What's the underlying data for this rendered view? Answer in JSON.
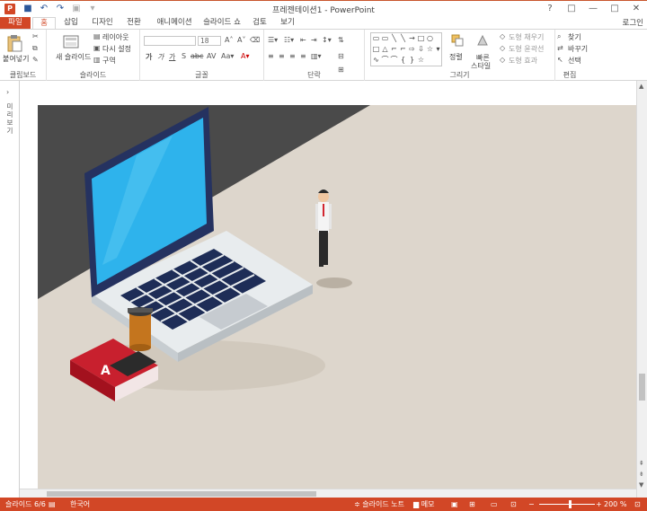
{
  "window": {
    "title": "프레젠테이션1 - PowerPoint",
    "app_letter": "P",
    "controls": [
      "?",
      "□",
      "—",
      "□",
      "✕"
    ]
  },
  "tabs": [
    {
      "label": "파일"
    },
    {
      "label": "홈"
    },
    {
      "label": "삽입"
    },
    {
      "label": "디자인"
    },
    {
      "label": "전환"
    },
    {
      "label": "애니메이션"
    },
    {
      "label": "슬라이드 쇼"
    },
    {
      "label": "검토"
    },
    {
      "label": "보기"
    }
  ],
  "account": "로그인",
  "ribbon": {
    "clipboard": {
      "paste": "붙여넣기",
      "label": "클립보드"
    },
    "slides": {
      "new_slide": "새 슬라이드",
      "layout": "레이아웃",
      "reset": "다시 설정",
      "section": "구역",
      "label": "슬라이드"
    },
    "font": {
      "size": "18",
      "label": "글꼴"
    },
    "paragraph": {
      "label": "단락"
    },
    "drawing": {
      "arrange": "정렬",
      "quick_styles_1": "빠른",
      "quick_styles_2": "스타일",
      "fill": "도형 채우기",
      "outline": "도형 윤곽선",
      "effects": "도형 효과",
      "label": "그리기"
    },
    "editing": {
      "find": "찾기",
      "replace": "바꾸기",
      "select": "선택",
      "label": "편집"
    }
  },
  "thumbnail_pane": {
    "label": "미리보기"
  },
  "status": {
    "slide_info": "슬라이드 6/6",
    "language": "한국어",
    "notes": "슬라이드 노트",
    "comments": "메모",
    "zoom": "200 %"
  },
  "colors": {
    "accent": "#d24726",
    "slide_dark": "#4a4a4a",
    "slide_floor": "#ddd6cc",
    "laptop_screen": "#2eb3ec",
    "book": "#c8202e"
  }
}
